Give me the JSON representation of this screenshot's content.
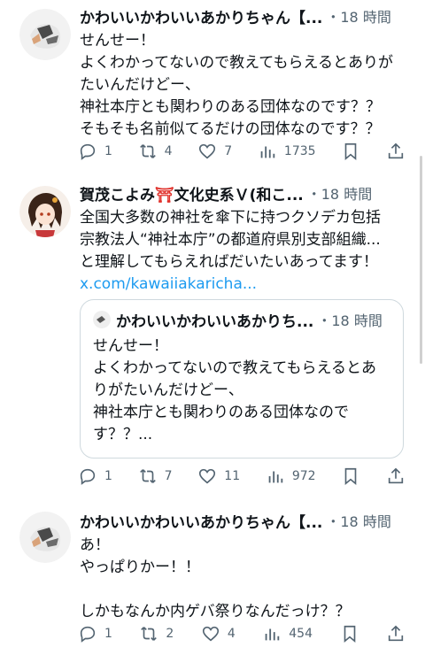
{
  "tweets": [
    {
      "name": "かわいいかわいいあかりちゃん【...",
      "time": "・18 時間",
      "lines": [
        "せんせー！",
        "よくわかってないので教えてもらえるとありが",
        "たいんだけどー、",
        "神社本庁とも関わりのある団体なのです？？",
        "そもそも名前似てるだけの団体なのです？？"
      ],
      "replies": "1",
      "reposts": "4",
      "likes": "7",
      "views": "1735"
    },
    {
      "name_prefix": "賀茂こよみ",
      "name_suffix": "文化史系Ｖ(和こ...",
      "time": "・18 時間",
      "lines": [
        "全国大多数の神社を傘下に持つクソデカ包括",
        "宗教法人“神社本庁”の都道府県別支部組織...",
        "と理解してもらえればだいたいあってます！"
      ],
      "link": "x.com/kawaiiakaricha...",
      "quote": {
        "name": "かわいいかわいいあかりち...",
        "time": "・18 時間",
        "lines": [
          "せんせー！",
          "よくわかってないので教えてもらえるとあ",
          "りがたいんだけどー、",
          "神社本庁とも関わりのある団体なので",
          "す？？..."
        ]
      },
      "replies": "1",
      "reposts": "7",
      "likes": "11",
      "views": "972"
    },
    {
      "name": "かわいいかわいいあかりちゃん【...",
      "time": "・18 時間",
      "lines": [
        "あ！",
        "やっぱりかー！！",
        "",
        "しかもなんか内ゲバ祭りなんだっけ？？"
      ],
      "replies": "1",
      "reposts": "2",
      "likes": "4",
      "views": "454"
    }
  ],
  "icons": [
    "reply-icon",
    "repost-icon",
    "like-icon",
    "views-icon",
    "bookmark-icon",
    "share-icon"
  ],
  "colors": {
    "text": "#0f1419",
    "muted": "#536471",
    "link": "#1d9bf0",
    "border": "#cfd9de"
  }
}
